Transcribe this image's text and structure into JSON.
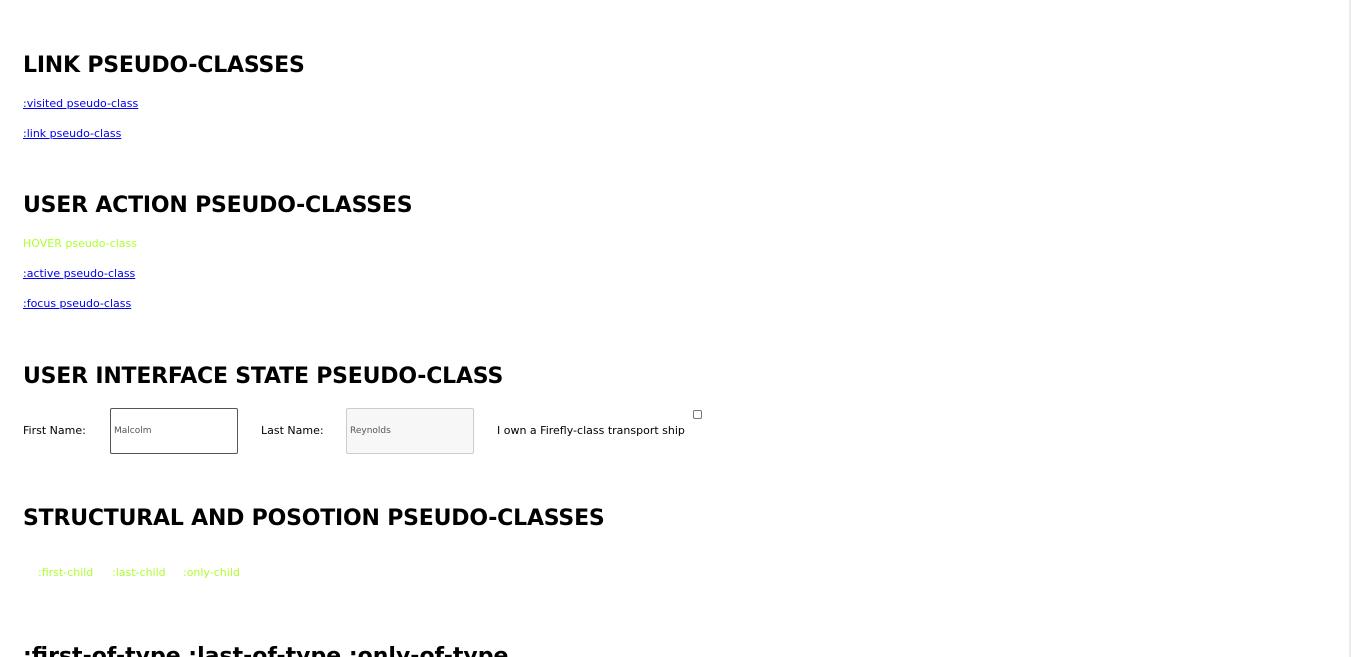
{
  "sections": {
    "link": {
      "heading": "LINK PSEUDO-CLASSES",
      "links": [
        ":visited pseudo-class",
        ":link pseudo-class"
      ]
    },
    "user_action": {
      "heading": "USER ACTION PSEUDO-CLASSES",
      "hover_link": "HOVER pseudo-class",
      "links": [
        ":active pseudo-class",
        ":focus pseudo-class"
      ]
    },
    "ui_state": {
      "heading": "USER INTERFACE STATE PSEUDO-CLASS",
      "first_name_label": "First Name:",
      "first_name_value": "Malcolm",
      "last_name_label": "Last Name:",
      "last_name_value": "Reynolds",
      "checkbox_label": "I own a Firefly-class transport ship",
      "checkbox_checked": false
    },
    "structural": {
      "heading": "STRUCTURAL AND POSOTION PSEUDO-CLASSES",
      "items": [
        ":first-child",
        ":last-child",
        ":only-child"
      ]
    },
    "next_partial": {
      "heading": ":first-of-type  :last-of-type  :only-of-type"
    }
  },
  "colors": {
    "link": "#0000ee",
    "greenyellow": "#adff2f",
    "text": "#000000"
  }
}
